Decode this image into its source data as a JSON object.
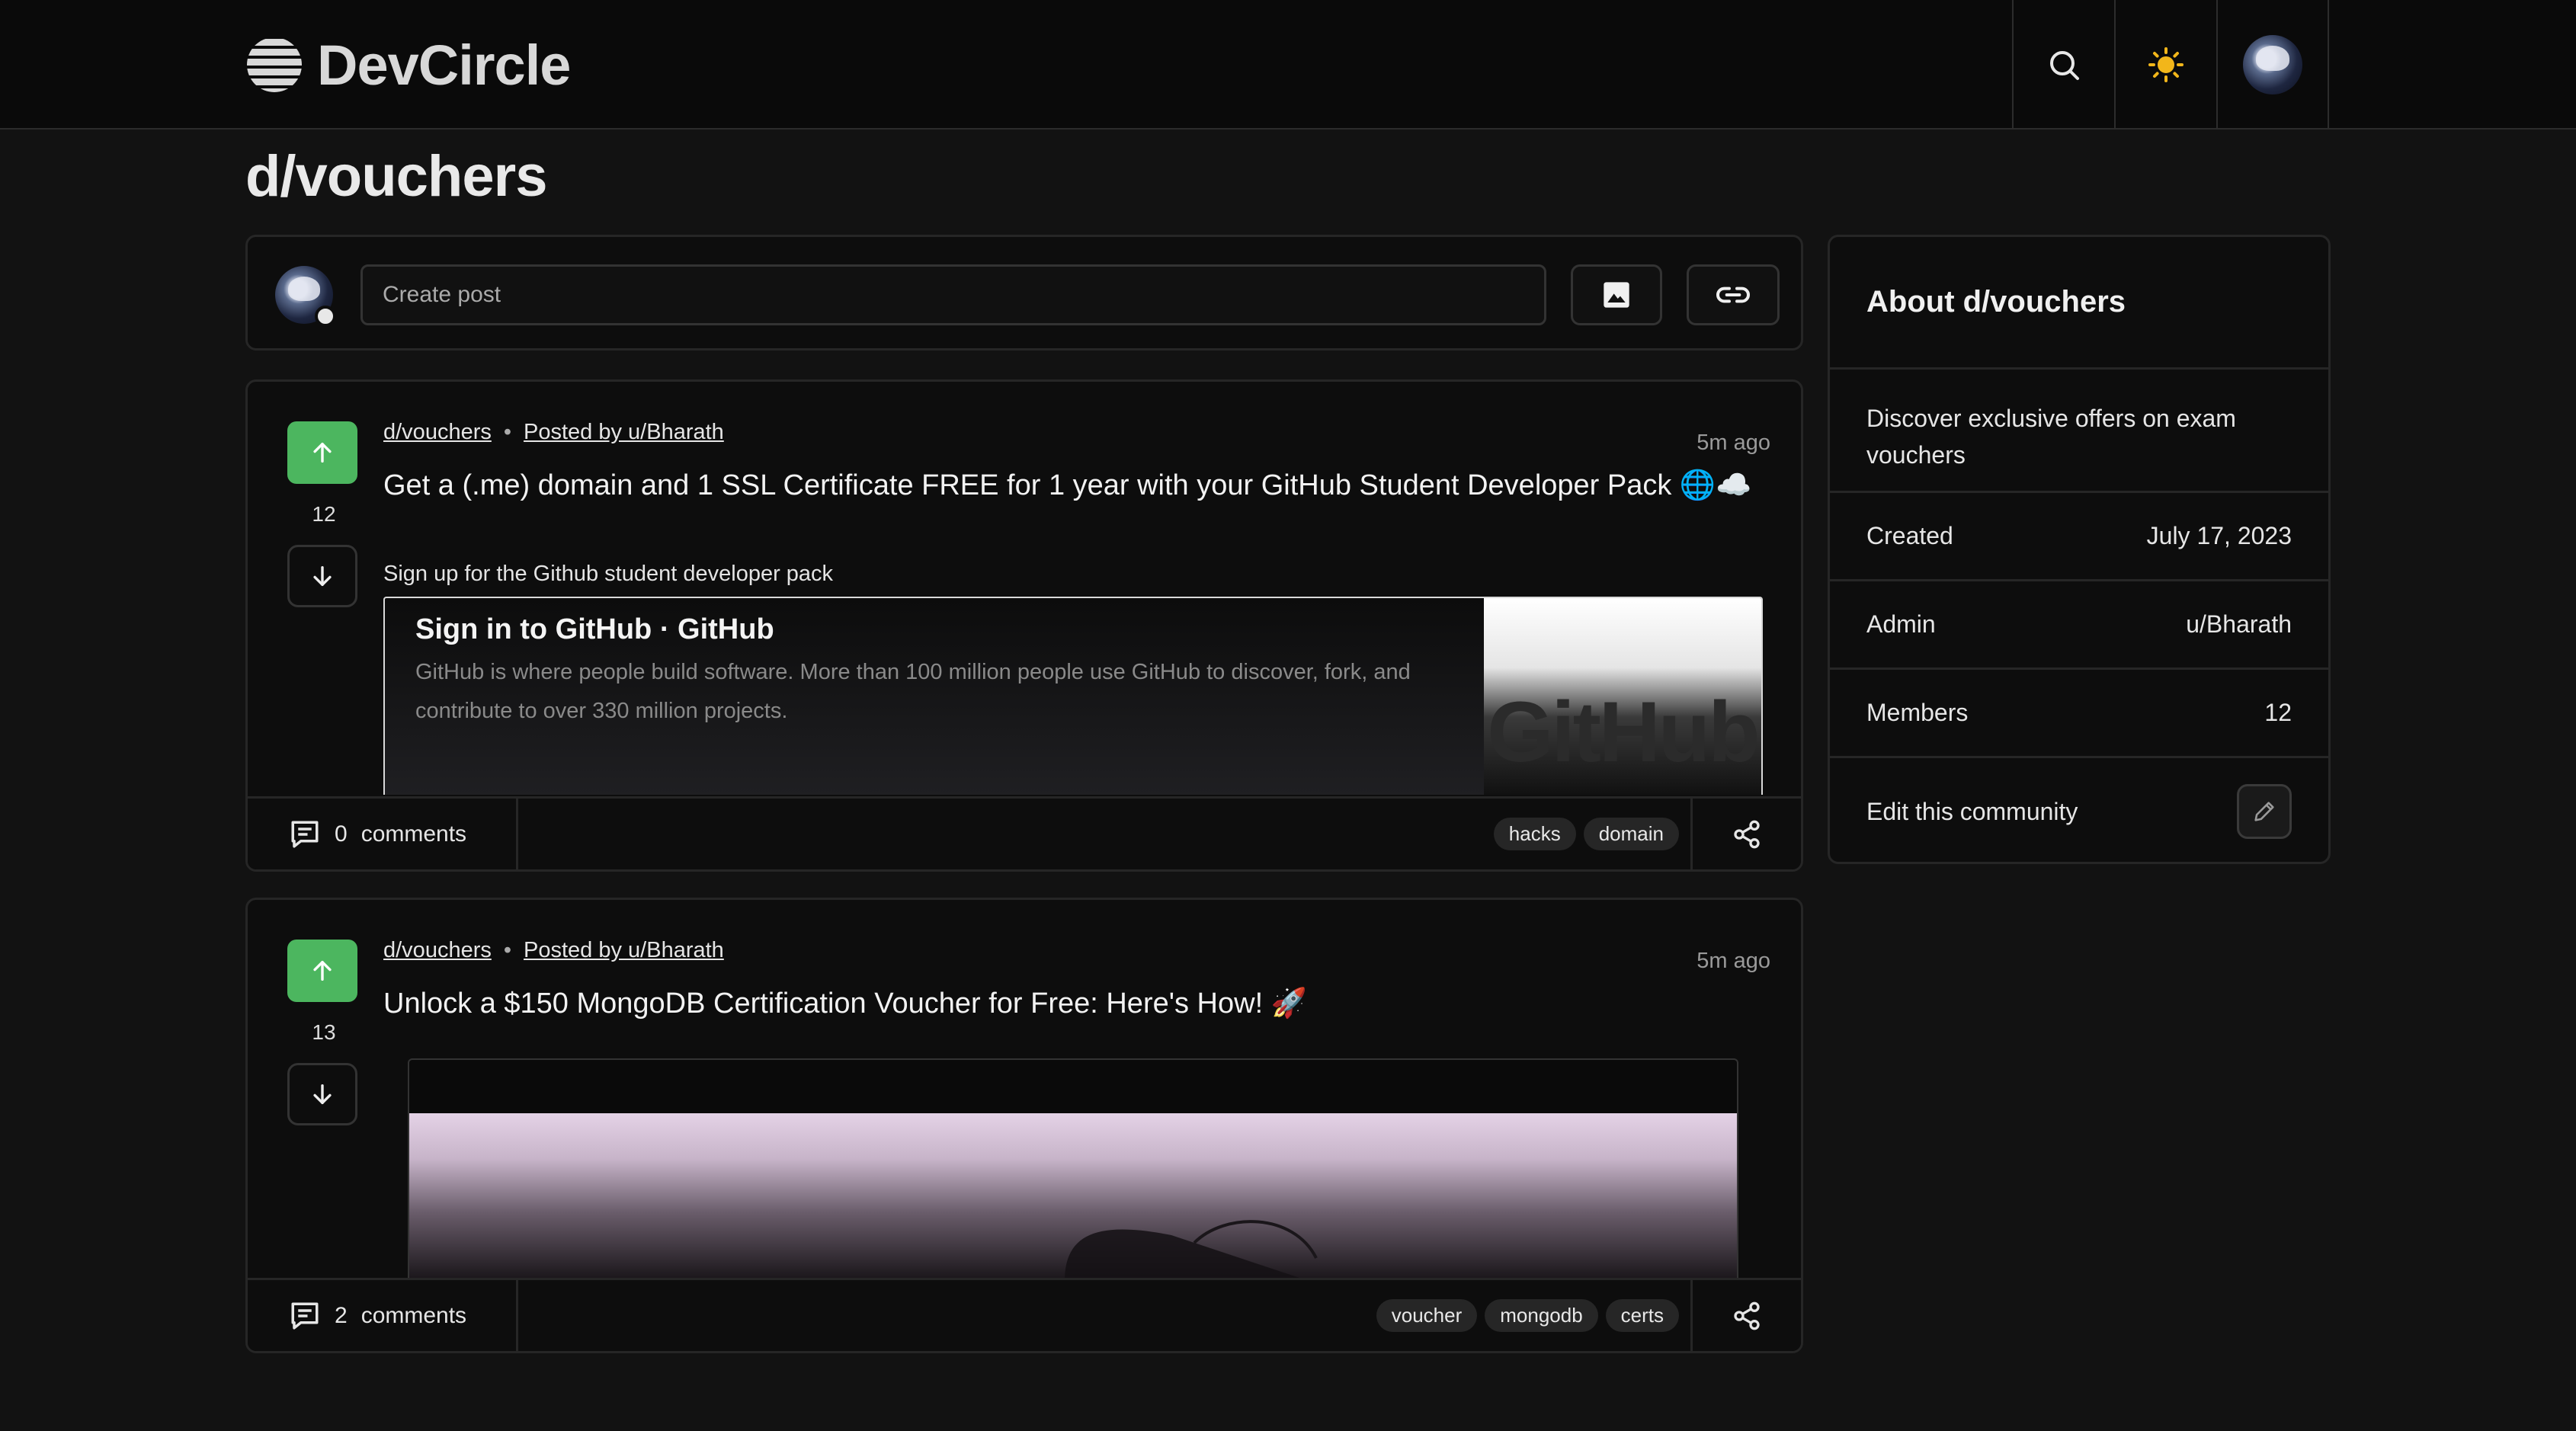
{
  "header": {
    "brand": "DevCircle",
    "icons": {
      "logo": "stacked-circle-logo-icon",
      "search": "search-icon",
      "theme": "sun-icon",
      "avatar": "user-avatar"
    }
  },
  "page": {
    "title": "d/vouchers"
  },
  "create_post": {
    "placeholder": "Create post",
    "image_icon": "image-icon",
    "link_icon": "link-icon"
  },
  "posts": [
    {
      "community": "d/vouchers",
      "posted_by": "Posted by u/Bharath",
      "time": "5m ago",
      "votes": "12",
      "title": "Get a (.me) domain and 1 SSL Certificate FREE for 1 year with your GitHub Student Developer Pack 🌐☁️",
      "description": "Sign up for the Github student developer pack",
      "embed": {
        "title": "Sign in to GitHub · GitHub",
        "description": "GitHub is where people build software. More than 100 million people use GitHub to discover, fork, and contribute to over 330 million projects.",
        "image_text": "GitHub"
      },
      "comments_count": "0",
      "comments_label": "comments",
      "tags": [
        "hacks",
        "domain"
      ]
    },
    {
      "community": "d/vouchers",
      "posted_by": "Posted by u/Bharath",
      "time": "5m ago",
      "votes": "13",
      "title": "Unlock a $150 MongoDB Certification Voucher for Free: Here's How! 🚀",
      "comments_count": "2",
      "comments_label": "comments",
      "tags": [
        "voucher",
        "mongodb",
        "certs"
      ]
    }
  ],
  "about": {
    "title": "About d/vouchers",
    "description": "Discover exclusive offers on exam vouchers",
    "rows": [
      {
        "label": "Created",
        "value": "July 17, 2023"
      },
      {
        "label": "Admin",
        "value": "u/Bharath"
      },
      {
        "label": "Members",
        "value": "12"
      }
    ],
    "edit_label": "Edit this community"
  },
  "colors": {
    "upvote": "#4cb65f",
    "background": "#121212",
    "card": "#0d0d0d"
  }
}
